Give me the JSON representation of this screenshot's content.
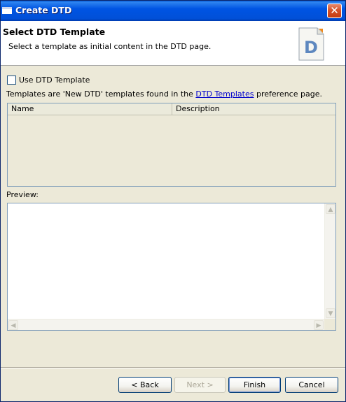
{
  "window": {
    "title": "Create DTD",
    "close_label": "✕"
  },
  "header": {
    "title": "Select DTD Template",
    "description": "Select a template as initial content in the DTD page.",
    "icon_letter": "D"
  },
  "options": {
    "use_template_label": "Use DTD Template",
    "use_template_checked": false
  },
  "info": {
    "prefix": "Templates are 'New DTD' templates found in the ",
    "link": "DTD Templates",
    "suffix": " preference page."
  },
  "templates_table": {
    "columns": [
      "Name",
      "Description"
    ],
    "rows": []
  },
  "preview": {
    "label": "Preview:",
    "content": ""
  },
  "buttons": {
    "back": "< Back",
    "next": "Next >",
    "finish": "Finish",
    "cancel": "Cancel"
  }
}
